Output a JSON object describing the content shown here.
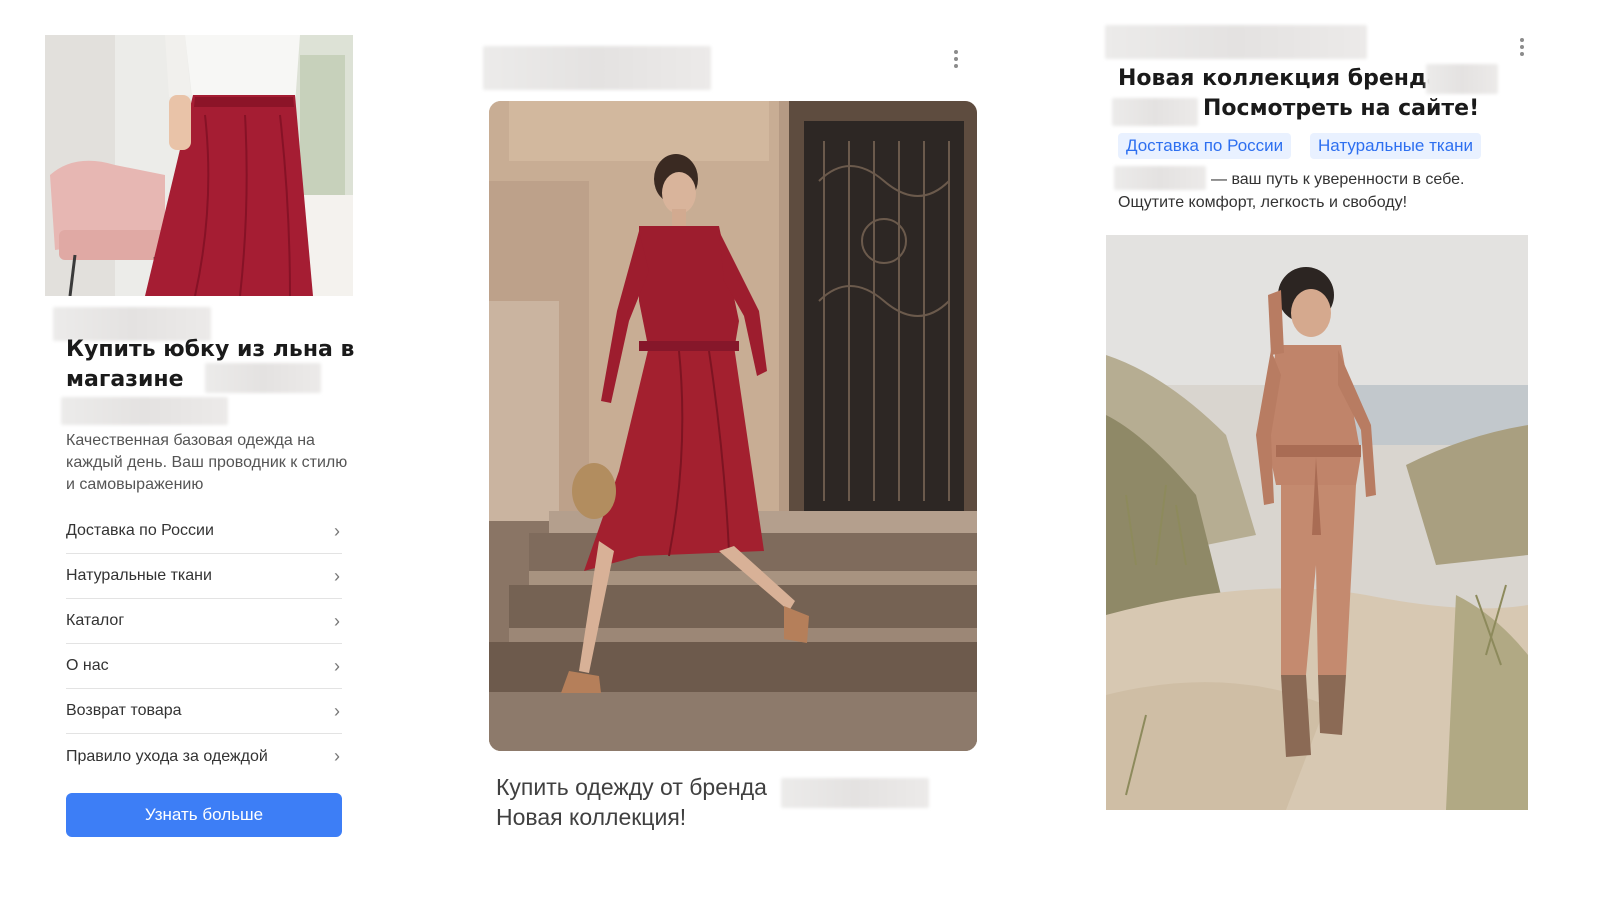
{
  "card1": {
    "title": "Купить юбку из льна в магазине",
    "description": "Качественная базовая одежда на каждый день. Ваш проводник к стилю и самовыражению",
    "sitelinks": [
      {
        "label": "Доставка по России"
      },
      {
        "label": "Натуральные ткани"
      },
      {
        "label": "Каталог"
      },
      {
        "label": "О нас"
      },
      {
        "label": "Возврат товара"
      },
      {
        "label": "Правило ухода за одеждой"
      }
    ],
    "chevron": "›",
    "cta_label": "Узнать больше"
  },
  "card2": {
    "caption_line1": "Купить одежду от бренда",
    "caption_line2": "Новая коллекция!"
  },
  "card3": {
    "title_line1": "Новая коллекция бренда",
    "title_line2": "Посмотреть на сайте!",
    "chips": [
      "Доставка по России",
      "Натуральные ткани"
    ],
    "desc_line1": "— ваш путь к уверенности в себе.",
    "desc_line2": "Ощутите комфорт, легкость и свободу!"
  },
  "colors": {
    "accent": "#3d7ef6",
    "chip_bg": "#e9f1ff",
    "chip_text": "#2d6ff0"
  },
  "icons": [
    "more-vertical-icon",
    "chevron-right-icon"
  ]
}
